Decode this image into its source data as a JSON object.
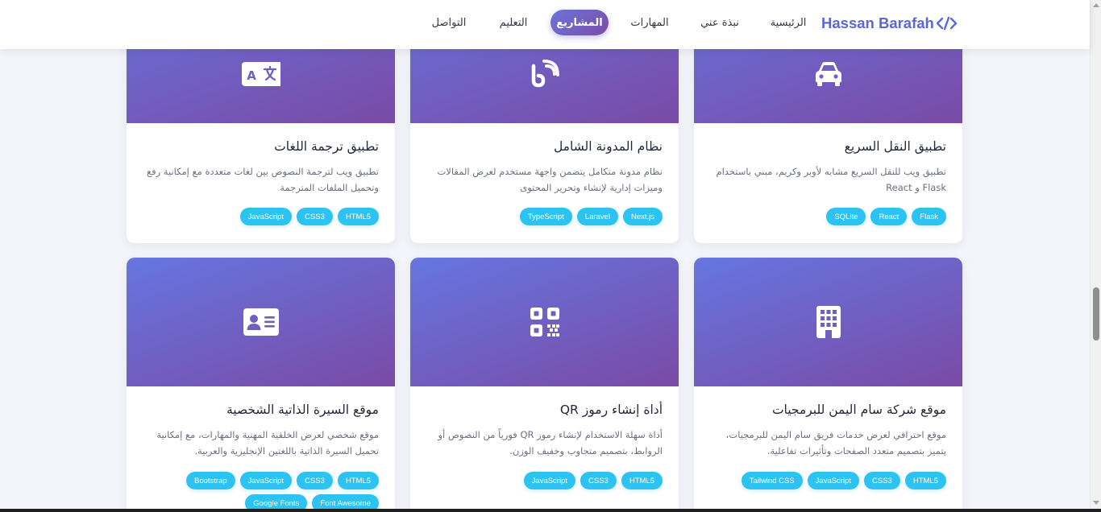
{
  "header": {
    "logo_text": "Hassan Barafah",
    "logo_icon": "code-icon",
    "nav": [
      {
        "label": "الرئيسية",
        "active": false
      },
      {
        "label": "نبذة عني",
        "active": false
      },
      {
        "label": "المهارات",
        "active": false
      },
      {
        "label": "المشاريع",
        "active": true
      },
      {
        "label": "التعليم",
        "active": false
      },
      {
        "label": "التواصل",
        "active": false
      }
    ],
    "accent_color": "#5a67d8"
  },
  "projects": [
    {
      "title": "تطبيق النقل السريع",
      "description": "تطبيق ويب للنقل السريع مشابه لأوبر وكريم، مبني باستخدام Flask و React",
      "icon": "car-icon",
      "tags": [
        "Flask",
        "React",
        "SQLite"
      ]
    },
    {
      "title": "نظام المدونة الشامل",
      "description": "نظام مدونة متكامل يتضمن واجهة مستخدم لعرض المقالات وميزات إدارية لإنشاء وتحرير المحتوى",
      "icon": "blog-icon",
      "tags": [
        "Next.js",
        "Laravel",
        "TypeScript"
      ]
    },
    {
      "title": "تطبيق ترجمة اللغات",
      "description": "تطبيق ويب لترجمة النصوص بين لغات متعددة مع إمكانية رفع وتحميل الملفات المترجمة",
      "icon": "language-icon",
      "tags": [
        "HTML5",
        "CSS3",
        "JavaScript"
      ]
    },
    {
      "title": "موقع شركة سام اليمن للبرمجيات",
      "description": "موقع احترافي لعرض خدمات فريق سام اليمن للبرمجيات، يتميز بتصميم متعدد الصفحات وتأثيرات تفاعلية.",
      "icon": "building-icon",
      "tags": [
        "HTML5",
        "CSS3",
        "JavaScript",
        "Tailwind CSS"
      ]
    },
    {
      "title": "أداة إنشاء رموز QR",
      "description": "أداة سهلة الاستخدام لإنشاء رموز QR فورياً من النصوص أو الروابط، بتصميم متجاوب وخفيف الوزن.",
      "icon": "qrcode-icon",
      "tags": [
        "HTML5",
        "CSS3",
        "JavaScript"
      ]
    },
    {
      "title": "موقع السيرة الذاتية الشخصية",
      "description": "موقع شخصي لعرض الخلفية المهنية والمهارات، مع إمكانية تحميل السيرة الذاتية باللغتين الإنجليزية والعربية.",
      "icon": "id-card-icon",
      "tags": [
        "HTML5",
        "CSS3",
        "JavaScript",
        "Bootstrap",
        "Font Awesome",
        "Google Fonts"
      ]
    }
  ],
  "colors": {
    "banner_gradient_start": "#6576e0",
    "banner_gradient_end": "#7a4aa6",
    "tag_background": "#2cc3f3"
  }
}
